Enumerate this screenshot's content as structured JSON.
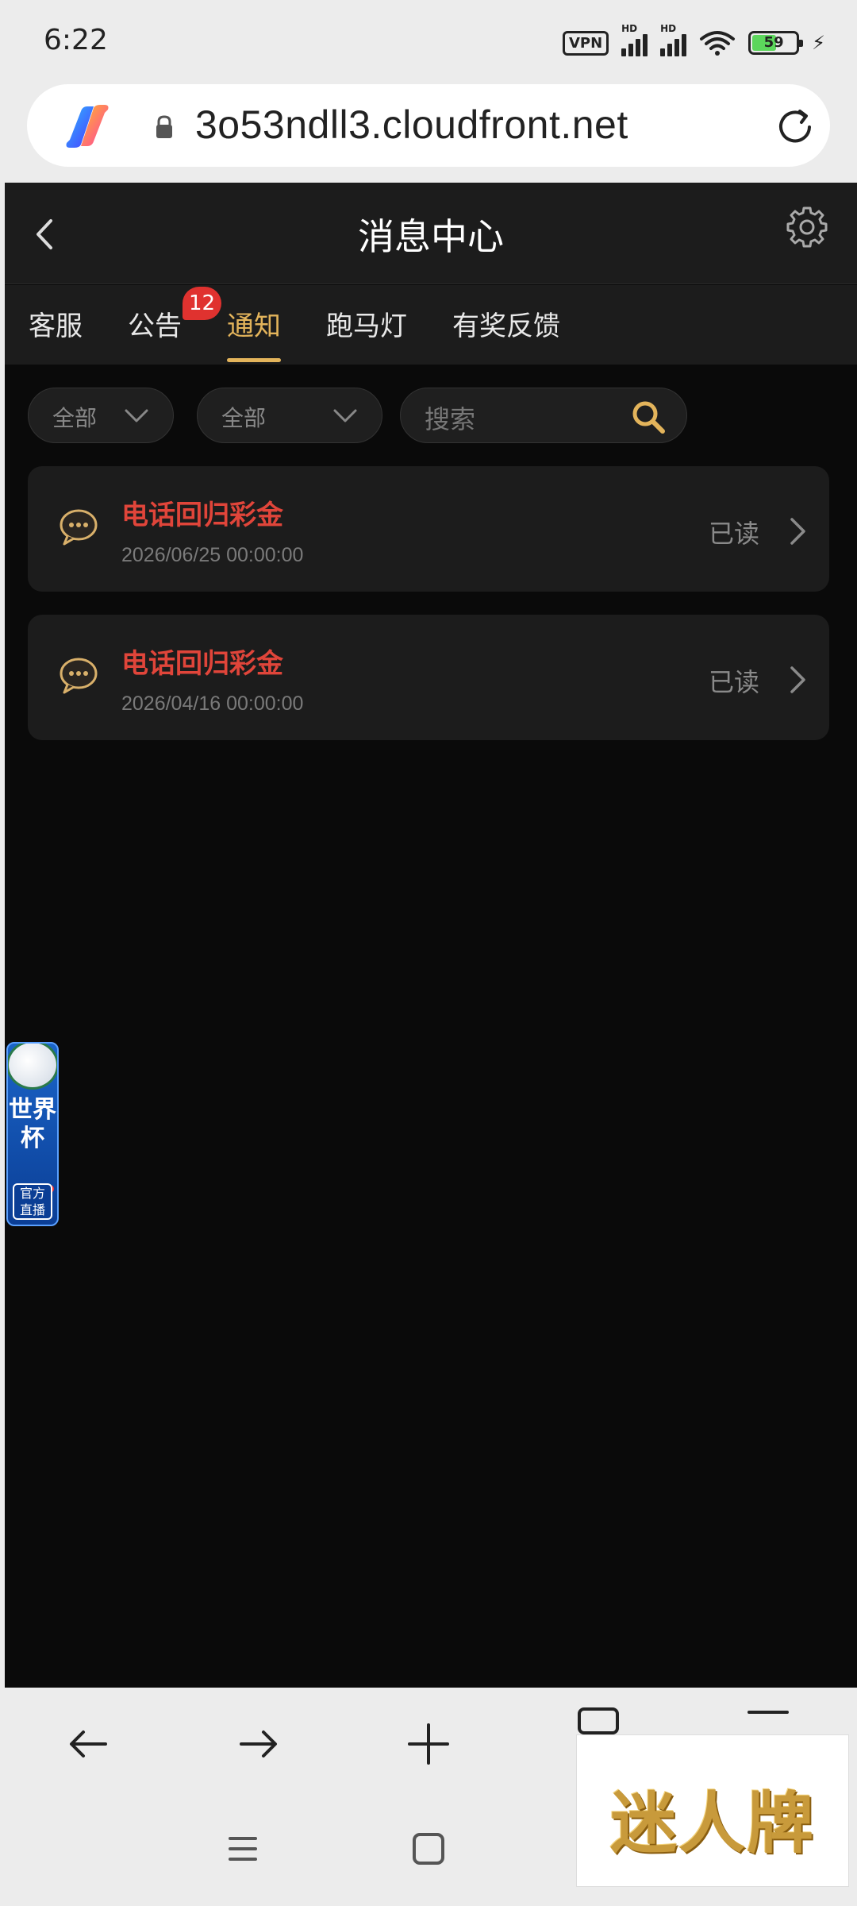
{
  "status_bar": {
    "time": "6:22",
    "vpn": "VPN",
    "hd": "HD",
    "battery": "59"
  },
  "browser": {
    "url": "3o53ndll3.cloudfront.net"
  },
  "header": {
    "title": "消息中心"
  },
  "tabs": [
    {
      "label": "客服"
    },
    {
      "label": "公告",
      "badge": "12"
    },
    {
      "label": "通知",
      "active": true
    },
    {
      "label": "跑马灯"
    },
    {
      "label": "有奖反馈"
    }
  ],
  "filters": {
    "filter1": "全部",
    "filter2": "全部",
    "search_placeholder": "搜索"
  },
  "messages": [
    {
      "title": "电话回归彩金",
      "date": "2026/06/25 00:00:00",
      "status": "已读"
    },
    {
      "title": "电话回归彩金",
      "date": "2026/04/16 00:00:00",
      "status": "已读"
    }
  ],
  "floating_widget": {
    "text": "世界杯",
    "badge": "官方\n直播"
  },
  "brand_overlay": {
    "text": "迷人牌"
  },
  "colors": {
    "accent": "#e3b45b",
    "title_red": "#e0453a",
    "background": "#0a0a0a",
    "card": "#1c1c1c"
  }
}
